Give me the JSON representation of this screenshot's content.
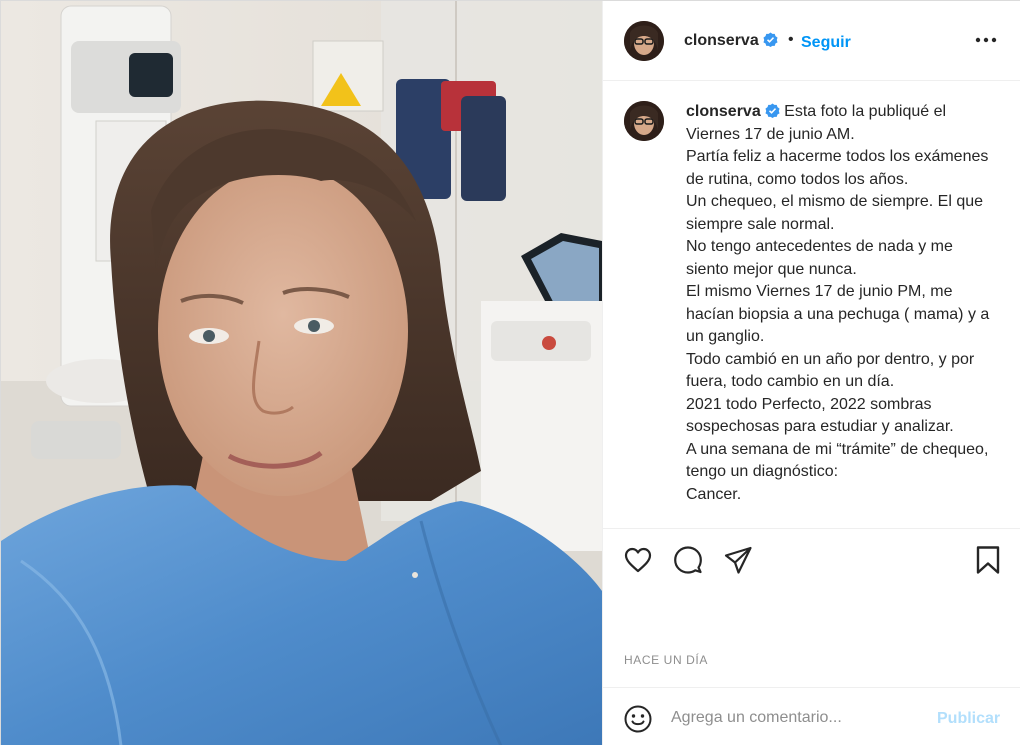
{
  "post": {
    "username": "clonserva",
    "verified": true,
    "follow_label": "Seguir",
    "separator": "•",
    "photo_icon": "selfie-photo",
    "caption": {
      "intro": "Esta foto la publiqué el Viernes 17 de junio AM.",
      "lines": [
        "Partía feliz a hacerme todos los exámenes de rutina, como todos los años.",
        "Un chequeo, el mismo de siempre. El que siempre sale normal.",
        "No tengo antecedentes de nada y me siento mejor que nunca.",
        "El mismo Viernes 17 de junio PM, me hacían biopsia a una pechuga ( mama) y a un ganglio.",
        "Todo cambió en un año por dentro, y por fuera, todo cambio en un día.",
        "2021 todo Perfecto, 2022 sombras sospechosas para estudiar y analizar.",
        "A una semana de mi “trámite” de chequeo, tengo un diagnóstico:",
        "Cancer."
      ]
    },
    "timestamp": "HACE UN DÍA",
    "comment": {
      "placeholder": "Agrega un comentario...",
      "publish_label": "Publicar"
    }
  },
  "icons": {
    "like": "heart-icon",
    "comment": "comment-bubble-icon",
    "share": "paper-plane-icon",
    "save": "bookmark-icon",
    "more": "more-options-icon",
    "emoji": "smiley-icon",
    "verified": "verified-badge-icon"
  },
  "colors": {
    "link_blue": "#0095f6",
    "publish_disabled": "#b2dffc",
    "verified_blue": "#3897f0",
    "muted_text": "#8e8e8e",
    "text": "#262626"
  }
}
